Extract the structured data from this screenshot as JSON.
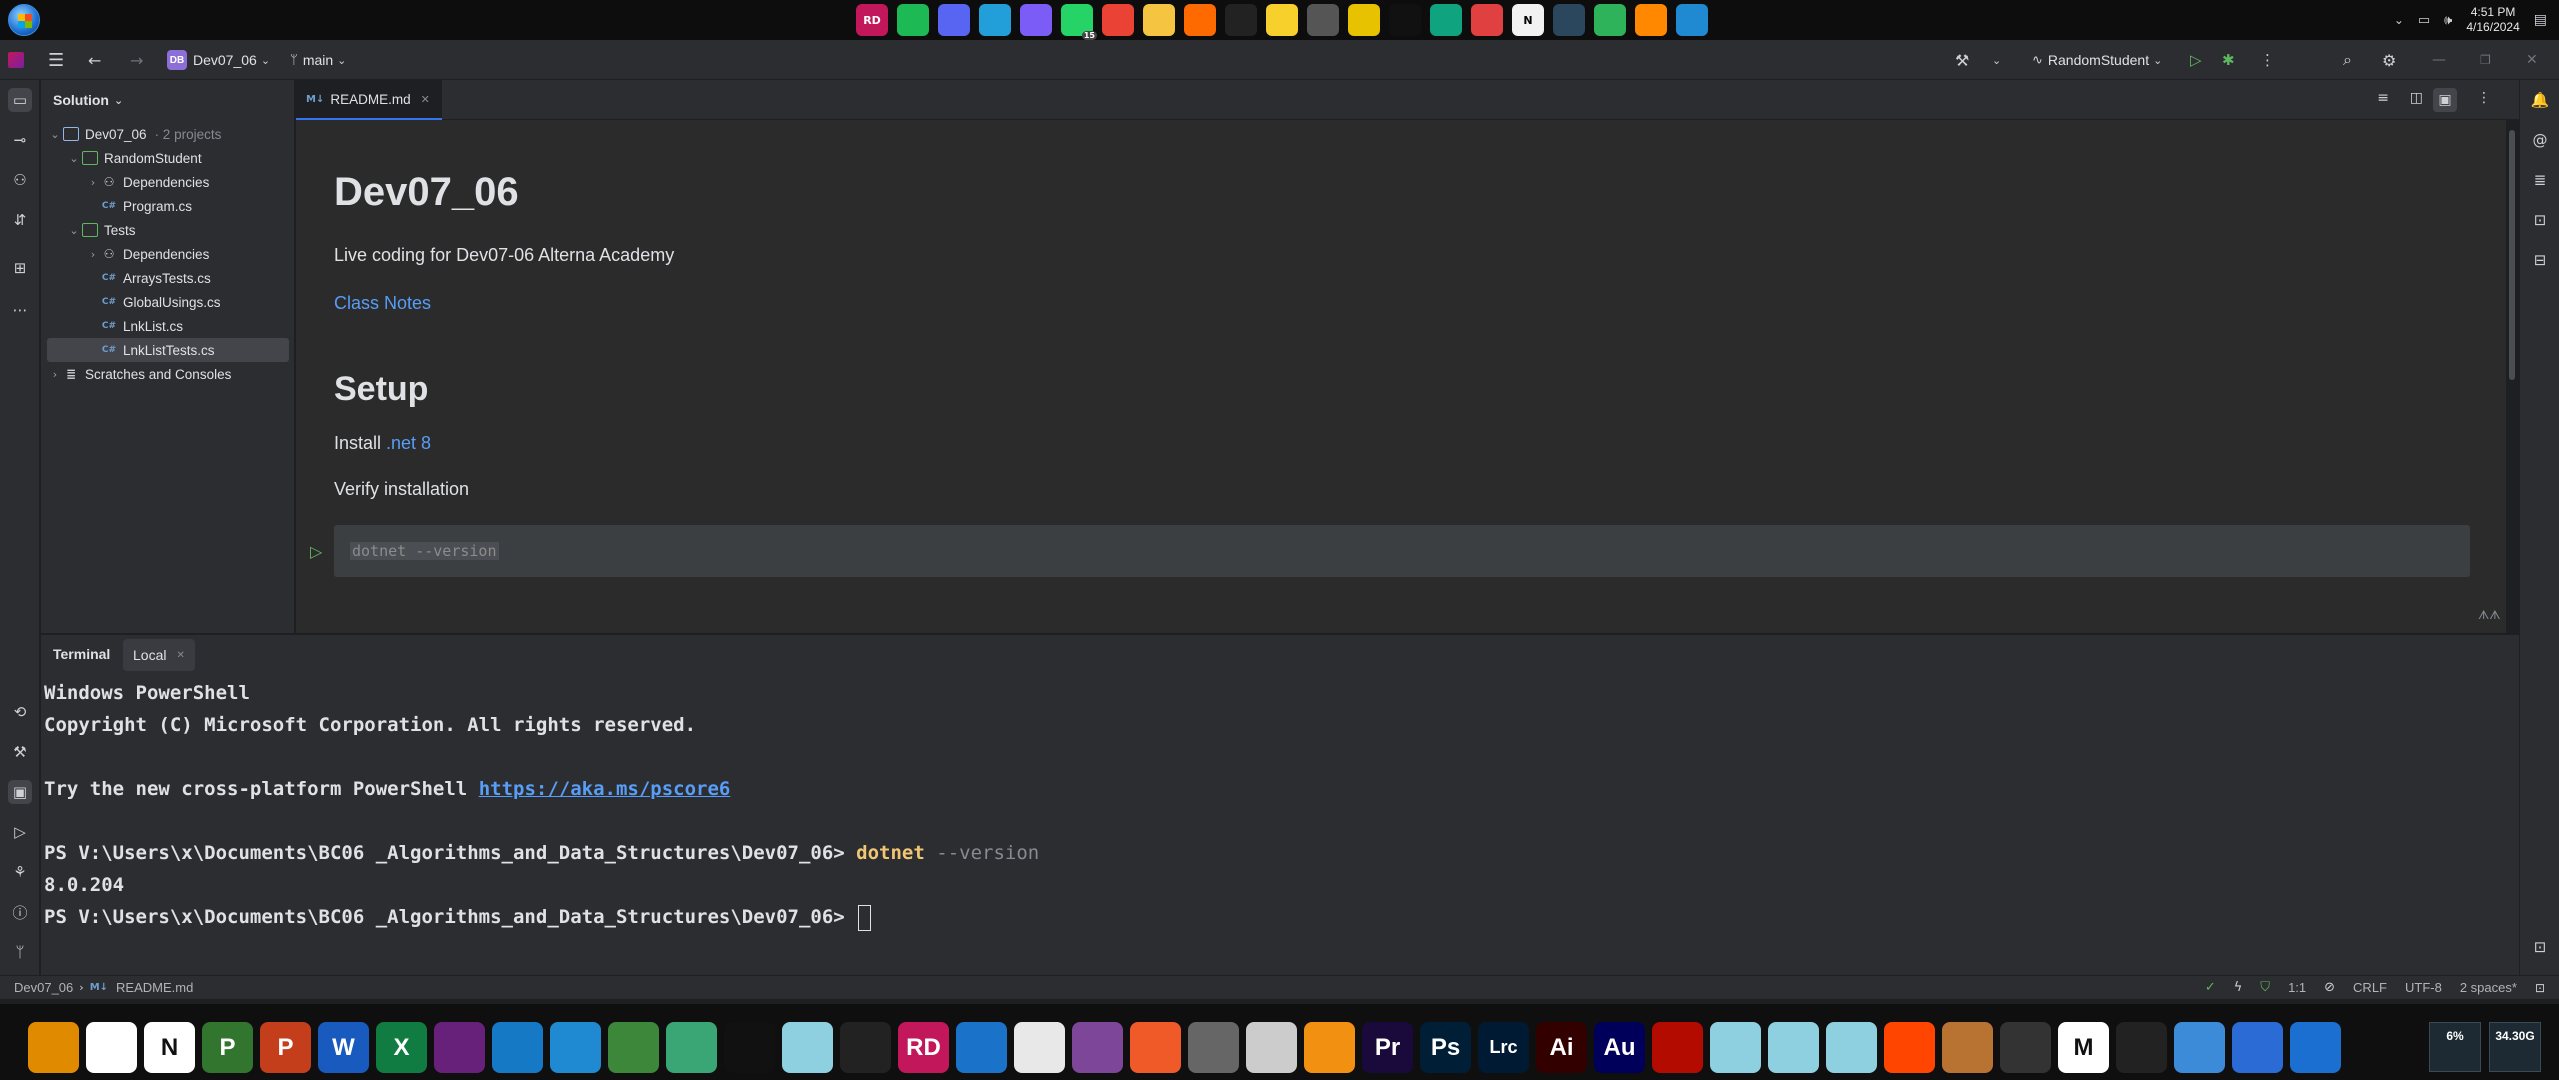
{
  "os": {
    "clock_time": "4:51 PM",
    "clock_date": "4/16/2024",
    "tray_badge": "15",
    "top_apps": [
      {
        "name": "rider-app",
        "color": "#c2185b",
        "label": "RD"
      },
      {
        "name": "spotify-app",
        "color": "#1db954",
        "label": ""
      },
      {
        "name": "discord-app",
        "color": "#5865f2",
        "label": ""
      },
      {
        "name": "telegram-app",
        "color": "#229ed9",
        "label": ""
      },
      {
        "name": "messenger-app",
        "color": "#7b5cf6",
        "label": ""
      },
      {
        "name": "whatsapp-app",
        "color": "#25d366",
        "label": ""
      },
      {
        "name": "chrome-app",
        "color": "#ea4335",
        "label": ""
      },
      {
        "name": "explorer-app",
        "color": "#f5c542",
        "label": ""
      },
      {
        "name": "fire-app",
        "color": "#ff6a00",
        "label": ""
      },
      {
        "name": "tiktok-app",
        "color": "#222222",
        "label": ""
      },
      {
        "name": "sticky-notes-app",
        "color": "#f7d02c",
        "label": ""
      },
      {
        "name": "snip-tool-app",
        "color": "#555555",
        "label": ""
      },
      {
        "name": "authy-app",
        "color": "#e6c200",
        "label": ""
      },
      {
        "name": "arc-app",
        "color": "#111111",
        "label": ""
      },
      {
        "name": "openai-app",
        "color": "#10a37f",
        "label": ""
      },
      {
        "name": "calendar-app",
        "color": "#e04040",
        "label": ""
      },
      {
        "name": "notion-app",
        "color": "#f2f2f2",
        "label": "N"
      },
      {
        "name": "steam-app",
        "color": "#2a475e",
        "label": ""
      },
      {
        "name": "clion-app",
        "color": "#2fb35a",
        "label": ""
      },
      {
        "name": "vlc-app",
        "color": "#ff8800",
        "label": ""
      },
      {
        "name": "vscode-app",
        "color": "#1f8ad2",
        "label": ""
      }
    ]
  },
  "ide": {
    "project_badge": "DB",
    "project_name": "Dev07_06",
    "branch": "main",
    "run_config": "RandomStudent"
  },
  "solution": {
    "title": "Solution",
    "tree": [
      {
        "label": "Dev07_06",
        "note": "· 2 projects",
        "icon": "solution-icon",
        "depth": 0,
        "chevron": "⌄"
      },
      {
        "label": "RandomStudent",
        "note": "",
        "icon": "project-icon",
        "depth": 1,
        "chevron": "⌄"
      },
      {
        "label": "Dependencies",
        "note": "",
        "icon": "dependencies-icon",
        "depth": 2,
        "chevron": "›"
      },
      {
        "label": "Program.cs",
        "note": "",
        "icon": "csharp-file-icon",
        "depth": 2,
        "chevron": ""
      },
      {
        "label": "Tests",
        "note": "",
        "icon": "project-icon",
        "depth": 1,
        "chevron": "⌄"
      },
      {
        "label": "Dependencies",
        "note": "",
        "icon": "dependencies-icon",
        "depth": 2,
        "chevron": "›"
      },
      {
        "label": "ArraysTests.cs",
        "note": "",
        "icon": "csharp-file-icon",
        "depth": 2,
        "chevron": ""
      },
      {
        "label": "GlobalUsings.cs",
        "note": "",
        "icon": "csharp-file-icon",
        "depth": 2,
        "chevron": ""
      },
      {
        "label": "LnkList.cs",
        "note": "",
        "icon": "csharp-file-icon",
        "depth": 2,
        "chevron": ""
      },
      {
        "label": "LnkListTests.cs",
        "note": "",
        "icon": "csharp-file-icon",
        "depth": 2,
        "chevron": "",
        "selected": true
      },
      {
        "label": "Scratches and Consoles",
        "note": "",
        "icon": "scratches-icon",
        "depth": 0,
        "chevron": "›"
      }
    ]
  },
  "editor": {
    "tab_icon": "M↓",
    "tab_label": "README.md",
    "h1": "Dev07_06",
    "intro": "Live coding for Dev07-06 Alterna Academy",
    "class_notes": "Class Notes",
    "h2": "Setup",
    "install_prefix": "Install ",
    "install_link": ".net 8",
    "verify": "Verify installation",
    "code": "dotnet --version"
  },
  "terminal": {
    "title": "Terminal",
    "tab": "Local",
    "line1": "Windows PowerShell",
    "line2": "Copyright (C) Microsoft Corporation. All rights reserved.",
    "line3_prefix": "Try the new cross-platform PowerShell ",
    "line3_link": "https://aka.ms/pscore6",
    "prompt": "PS V:\\Users\\x\\Documents\\BC06 _Algorithms_and_Data_Structures\\Dev07_06> ",
    "cmd": "dotnet",
    "arg": " --version",
    "output": "8.0.204"
  },
  "status": {
    "crumb_project": "Dev07_06",
    "crumb_file": "README.md",
    "position": "1:1",
    "line_ending": "CRLF",
    "encoding": "UTF-8",
    "indent": "2 spaces*"
  },
  "taskbar": {
    "apps": [
      {
        "name": "clipboard-app",
        "color": "#e08a00",
        "label": ""
      },
      {
        "name": "unity-app",
        "color": "#ffffff",
        "label": ""
      },
      {
        "name": "notion-dock-app",
        "color": "#ffffff",
        "label": "N"
      },
      {
        "name": "project-app",
        "color": "#31752f",
        "label": "P"
      },
      {
        "name": "powerpoint-app",
        "color": "#c43e1c",
        "label": "P"
      },
      {
        "name": "word-app",
        "color": "#185abd",
        "label": "W"
      },
      {
        "name": "excel-app",
        "color": "#107c41",
        "label": "X"
      },
      {
        "name": "visual-studio-app",
        "color": "#68217a",
        "label": ""
      },
      {
        "name": "wireshark-app",
        "color": "#1679c6",
        "label": ""
      },
      {
        "name": "vscode-dock-app",
        "color": "#1f8ad2",
        "label": ""
      },
      {
        "name": "node-app",
        "color": "#3c873a",
        "label": ""
      },
      {
        "name": "atom-app",
        "color": "#3aa675",
        "label": ""
      },
      {
        "name": "terminal-app",
        "color": "#111111",
        "label": ""
      },
      {
        "name": "folder-app-1",
        "color": "#8fd0e0",
        "label": ""
      },
      {
        "name": "chatgpt-app",
        "color": "#222222",
        "label": ""
      },
      {
        "name": "rider-dock-app",
        "color": "#c2185b",
        "label": "RD"
      },
      {
        "name": "edge-app",
        "color": "#1a73c8",
        "label": ""
      },
      {
        "name": "git-app",
        "color": "#e8e8e8",
        "label": ""
      },
      {
        "name": "tor-app",
        "color": "#7d4698",
        "label": ""
      },
      {
        "name": "pen-app",
        "color": "#f05a28",
        "label": ""
      },
      {
        "name": "settings-gear-app",
        "color": "#666666",
        "label": ""
      },
      {
        "name": "pseint-app",
        "color": "#cccccc",
        "label": ""
      },
      {
        "name": "mysql-app",
        "color": "#f29111",
        "label": ""
      },
      {
        "name": "premiere-app",
        "color": "#1a0a3c",
        "label": "Pr"
      },
      {
        "name": "photoshop-app",
        "color": "#001e36",
        "label": "Ps"
      },
      {
        "name": "lightroom-app",
        "color": "#001a33",
        "label": "Lrc"
      },
      {
        "name": "illustrator-app",
        "color": "#330000",
        "label": "Ai"
      },
      {
        "name": "audition-app",
        "color": "#00005b",
        "label": "Au"
      },
      {
        "name": "acrobat-app",
        "color": "#b30b00",
        "label": ""
      },
      {
        "name": "folder-app-2",
        "color": "#8fd0e0",
        "label": ""
      },
      {
        "name": "folder-app-3",
        "color": "#8fd0e0",
        "label": ""
      },
      {
        "name": "folder-app-4",
        "color": "#8fd0e0",
        "label": ""
      },
      {
        "name": "flame-app",
        "color": "#ff4500",
        "label": ""
      },
      {
        "name": "cog-app",
        "color": "#b87333",
        "label": ""
      },
      {
        "name": "game-app",
        "color": "#333333",
        "label": ""
      },
      {
        "name": "mendeley-app",
        "color": "#ffffff",
        "label": "M"
      },
      {
        "name": "unity-hub-app",
        "color": "#222222",
        "label": ""
      },
      {
        "name": "robot-app",
        "color": "#3b8bd9",
        "label": ""
      },
      {
        "name": "webcam-app",
        "color": "#2a6bd6",
        "label": ""
      },
      {
        "name": "monitor-app",
        "color": "#1a6fd1",
        "label": ""
      }
    ],
    "cpu": "6%",
    "mem": "34.30G"
  }
}
